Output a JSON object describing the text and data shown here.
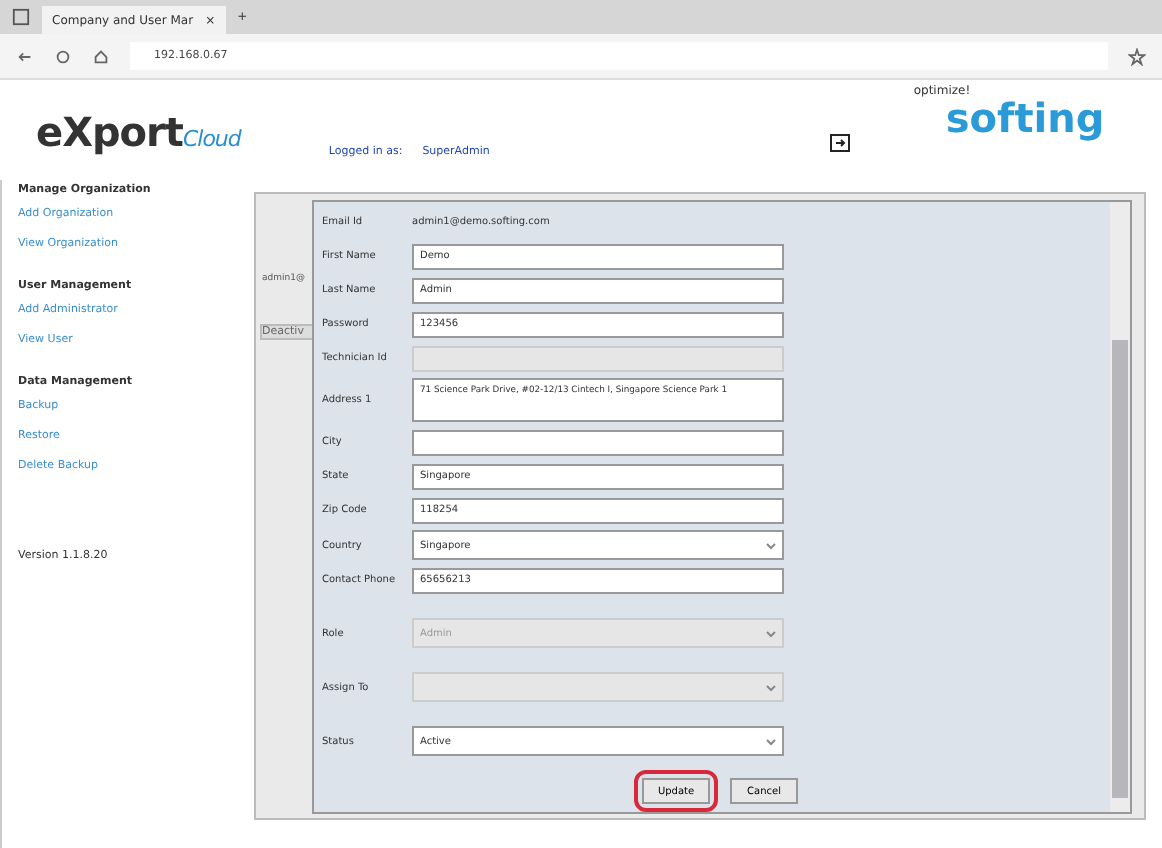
{
  "browser": {
    "tab_title": "Company and User Mar",
    "tab_close": "×",
    "new_tab": "+",
    "address": "192.168.0.67"
  },
  "header": {
    "logo_main": "eXport",
    "logo_sub": "Cloud",
    "logged_in_label": "Logged in as:",
    "user": "SuperAdmin",
    "brand_tagline": "optimize!",
    "brand": "softing"
  },
  "sidebar": {
    "sections": [
      {
        "title": "Manage Organization",
        "items": [
          "Add Organization",
          "View Organization"
        ]
      },
      {
        "title": "User Management",
        "items": [
          "Add Administrator",
          "View User"
        ]
      },
      {
        "title": "Data Management",
        "items": [
          "Backup",
          "Restore",
          "Delete Backup"
        ]
      }
    ],
    "version": "Version 1.1.8.20"
  },
  "background_table": {
    "cells": [
      "admin1@",
      "Deactiv"
    ]
  },
  "dialog": {
    "fields": [
      {
        "label": "Email Id",
        "kind": "static",
        "value": "admin1@demo.softing.com"
      },
      {
        "label": "First Name",
        "kind": "text",
        "value": "Demo"
      },
      {
        "label": "Last Name",
        "kind": "text",
        "value": "Admin"
      },
      {
        "label": "Password",
        "kind": "text",
        "value": "123456"
      },
      {
        "label": "Technician Id",
        "kind": "readonly"
      },
      {
        "label": "Address 1",
        "kind": "textarea",
        "value": "71 Science Park Drive, #02-12/13 Cintech I, Singapore Science Park 1"
      },
      {
        "label": "City",
        "kind": "text"
      },
      {
        "label": "State",
        "kind": "text",
        "value": "Singapore"
      },
      {
        "label": "Zip Code",
        "kind": "text",
        "value": "118254"
      },
      {
        "label": "Country",
        "kind": "select",
        "value": "Singapore",
        "disabled": false
      },
      {
        "label": "Contact Phone",
        "kind": "text",
        "value": "65656213"
      },
      {
        "label": "Role",
        "kind": "select",
        "value": "Admin",
        "disabled": true
      },
      {
        "label": "Assign To",
        "kind": "select",
        "disabled": true
      },
      {
        "label": "Status",
        "kind": "select",
        "value": "Active",
        "disabled": false
      }
    ],
    "buttons": [
      {
        "label": "Update",
        "highlighted": true
      },
      {
        "label": "Cancel",
        "highlighted": false
      }
    ]
  }
}
